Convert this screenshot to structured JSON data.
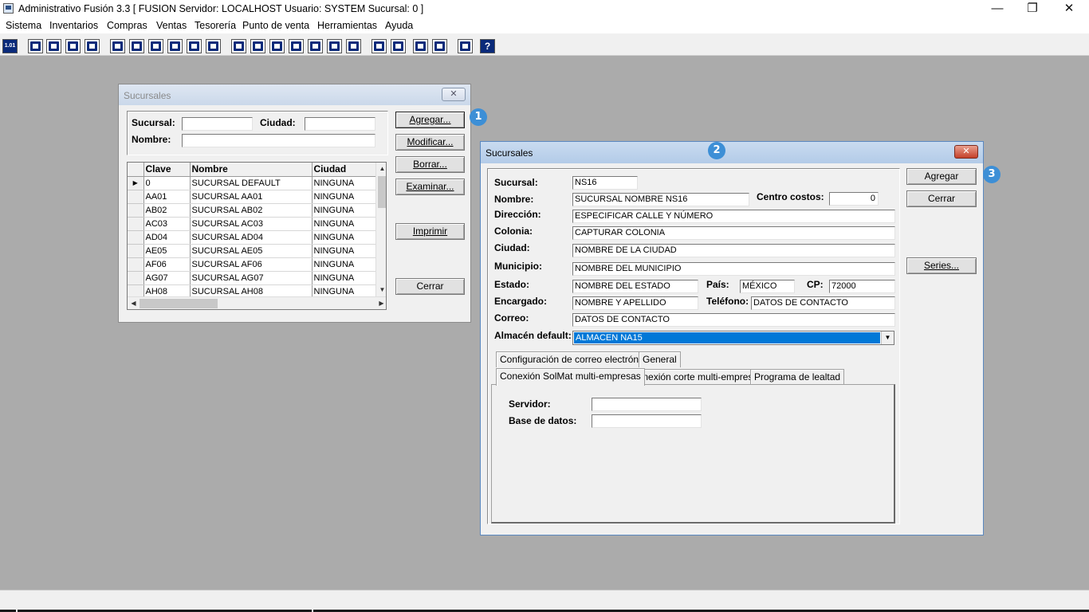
{
  "window": {
    "title": "Administrativo Fusión 3.3 [ FUSION   Servidor: LOCALHOST   Usuario: SYSTEM    Sucursal: 0 ]",
    "minimize": "—",
    "restore": "❐",
    "close": "✕"
  },
  "menu": [
    "Sistema",
    "Inventarios",
    "Compras",
    "Ventas",
    "Tesorería",
    "Punto de venta",
    "Herramientas",
    "Ayuda"
  ],
  "toolbar": {
    "icons": [
      "calculator-icon",
      "copy-icon",
      "document-icon",
      "transfer-icon",
      "search-doc-icon",
      "user-icon",
      "folder-icon",
      "print-icon",
      "printer-icon",
      "report-icon",
      "list-icon",
      "people-icon",
      "window-icon",
      "export-icon",
      "add-icon",
      "dollar-icon",
      "page-icon",
      "table-icon",
      "home-icon",
      "find-icon",
      "refresh-icon",
      "undo-icon",
      "back-icon",
      "help-icon"
    ],
    "first_label": "1.01",
    "help_label": "?"
  },
  "branch_list_dialog": {
    "title": "Sucursales",
    "close": "✕",
    "filter": {
      "sucursal_label": "Sucursal:",
      "sucursal_value": "",
      "ciudad_label": "Ciudad:",
      "ciudad_value": "",
      "nombre_label": "Nombre:",
      "nombre_value": ""
    },
    "buttons": {
      "agregar": "Agregar...",
      "modificar": "Modificar...",
      "borrar": "Borrar...",
      "examinar": "Examinar...",
      "imprimir": "Imprimir",
      "cerrar": "Cerrar"
    },
    "badge": "1",
    "grid": {
      "columns": [
        "Clave",
        "Nombre",
        "Ciudad"
      ],
      "current_row_marker": "▶",
      "rows": [
        {
          "clave": "0",
          "nombre": "SUCURSAL DEFAULT",
          "ciudad": "NINGUNA"
        },
        {
          "clave": "AA01",
          "nombre": "SUCURSAL AA01",
          "ciudad": "NINGUNA"
        },
        {
          "clave": "AB02",
          "nombre": "SUCURSAL AB02",
          "ciudad": "NINGUNA"
        },
        {
          "clave": "AC03",
          "nombre": "SUCURSAL AC03",
          "ciudad": "NINGUNA"
        },
        {
          "clave": "AD04",
          "nombre": "SUCURSAL AD04",
          "ciudad": "NINGUNA"
        },
        {
          "clave": "AE05",
          "nombre": "SUCURSAL AE05",
          "ciudad": "NINGUNA"
        },
        {
          "clave": "AF06",
          "nombre": "SUCURSAL AF06",
          "ciudad": "NINGUNA"
        },
        {
          "clave": "AG07",
          "nombre": "SUCURSAL AG07",
          "ciudad": "NINGUNA"
        },
        {
          "clave": "AH08",
          "nombre": "SUCURSAL AH08",
          "ciudad": "NINGUNA"
        }
      ]
    }
  },
  "branch_edit_dialog": {
    "title": "Sucursales",
    "close": "✕",
    "badge_title": "2",
    "badge_add": "3",
    "fields": {
      "sucursal": {
        "label": "Sucursal:",
        "value": "NS16"
      },
      "nombre": {
        "label": "Nombre:",
        "value": "SUCURSAL NOMBRE NS16"
      },
      "centro_costos": {
        "label": "Centro  costos:",
        "value": "0"
      },
      "direccion": {
        "label": "Dirección:",
        "value": "ESPECIFICAR CALLE Y NÚMERO"
      },
      "colonia": {
        "label": "Colonia:",
        "value": "CAPTURAR COLONIA"
      },
      "ciudad": {
        "label": "Ciudad:",
        "value": "NOMBRE DE LA CIUDAD"
      },
      "municipio": {
        "label": "Municipio:",
        "value": "NOMBRE DEL MUNICIPIO"
      },
      "estado": {
        "label": "Estado:",
        "value": "NOMBRE DEL ESTADO"
      },
      "pais": {
        "label": "País:",
        "value": "MÉXICO"
      },
      "cp": {
        "label": "CP:",
        "value": "72000"
      },
      "encargado": {
        "label": "Encargado:",
        "value": "NOMBRE Y APELLIDO"
      },
      "telefono": {
        "label": "Teléfono:",
        "value": "DATOS DE CONTACTO"
      },
      "correo": {
        "label": "Correo:",
        "value": "DATOS DE CONTACTO"
      },
      "almacen": {
        "label": "Almacén default:",
        "value": "ALMACEN NA15"
      }
    },
    "tabs_row1": [
      "Configuración de correo electrónico",
      "General"
    ],
    "tabs_row2": [
      "Conexión SolMat multi-empresas",
      "Conexión corte multi-empresas",
      "Programa de lealtad"
    ],
    "tab_panel": {
      "servidor_label": "Servidor:",
      "servidor_value": "",
      "base_label": "Base de datos:",
      "base_value": ""
    },
    "buttons": {
      "agregar": "Agregar",
      "cerrar": "Cerrar",
      "series": "Series..."
    }
  }
}
